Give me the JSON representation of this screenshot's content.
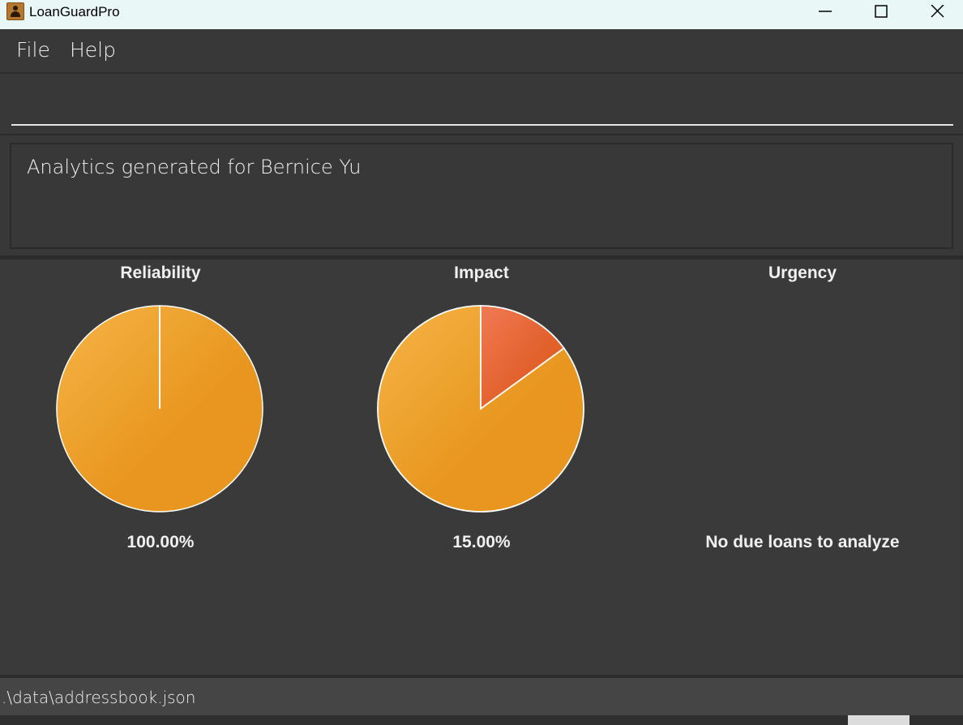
{
  "window": {
    "title": "LoanGuardPro",
    "icon": "person-contact-icon"
  },
  "menu": {
    "items": [
      {
        "label": "File"
      },
      {
        "label": "Help"
      }
    ]
  },
  "command": {
    "value": "",
    "placeholder": ""
  },
  "result": {
    "message": "Analytics generated for Bernice Yu"
  },
  "analytics": {
    "reliability": {
      "title": "Reliability",
      "value_text": "100.00%"
    },
    "impact": {
      "title": "Impact",
      "value_text": "15.00%"
    },
    "urgency": {
      "title": "Urgency",
      "value_text": "No due loans to analyze"
    }
  },
  "status": {
    "file_path": ".\\data\\addressbook.json"
  },
  "colors": {
    "pie_primary": "#e8961f",
    "pie_secondary": "#e2602a",
    "background": "#383838"
  },
  "chart_data": [
    {
      "type": "pie",
      "title": "Reliability",
      "values": [
        1.0
      ],
      "annotations": [
        "100.00%"
      ]
    },
    {
      "type": "pie",
      "title": "Impact",
      "values": [
        0.15,
        0.85
      ],
      "annotations": [
        "15.00%"
      ]
    },
    {
      "type": "pie",
      "title": "Urgency",
      "values": [],
      "annotations": [
        "No due loans to analyze"
      ]
    }
  ]
}
